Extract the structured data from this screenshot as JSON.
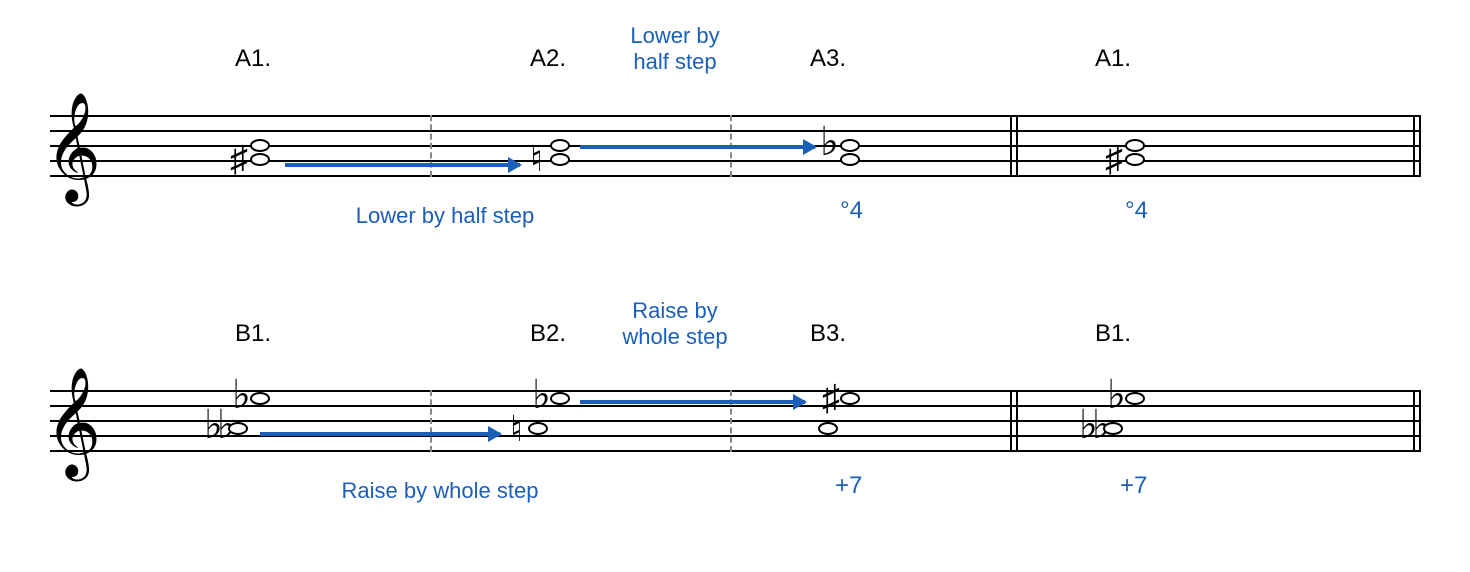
{
  "rowA": {
    "labels": {
      "a1": "A1.",
      "a2": "A2.",
      "a3": "A3.",
      "a1b": "A1."
    },
    "annotation_upper": "Lower by\nhalf step",
    "annotation_lower": "Lower by half step",
    "interval_a3": "°4",
    "interval_a1b": "°4",
    "measures": [
      {
        "id": "A1",
        "accidental": "sharp",
        "bottomNotePos": 45,
        "topNotePos": 30
      },
      {
        "id": "A2",
        "accidental": "natural",
        "bottomNotePos": 45,
        "topNotePos": 30
      },
      {
        "id": "A3",
        "accidentalTop": "flat",
        "bottomNotePos": 45,
        "topNotePos": 30
      },
      {
        "id": "A1b",
        "accidental": "sharp",
        "bottomNotePos": 45,
        "topNotePos": 30
      }
    ]
  },
  "rowB": {
    "labels": {
      "b1": "B1.",
      "b2": "B2.",
      "b3": "B3.",
      "b1b": "B1."
    },
    "annotation_upper": "Raise by\nwhole step",
    "annotation_lower": "Raise by whole step",
    "interval_b3": "+7",
    "interval_b1b": "+7",
    "measures": [
      {
        "id": "B1",
        "accTop": "flat",
        "accBot": "dblflat",
        "bottomNotePos": 37,
        "topNotePos": 7
      },
      {
        "id": "B2",
        "accTop": "flat",
        "accBot": "natural",
        "bottomNotePos": 37,
        "topNotePos": 7
      },
      {
        "id": "B3",
        "accTop": "sharp",
        "bottomNotePos": 37,
        "topNotePos": 7
      },
      {
        "id": "B1b",
        "accTop": "flat",
        "accBot": "dblflat",
        "bottomNotePos": 37,
        "topNotePos": 7
      }
    ]
  }
}
